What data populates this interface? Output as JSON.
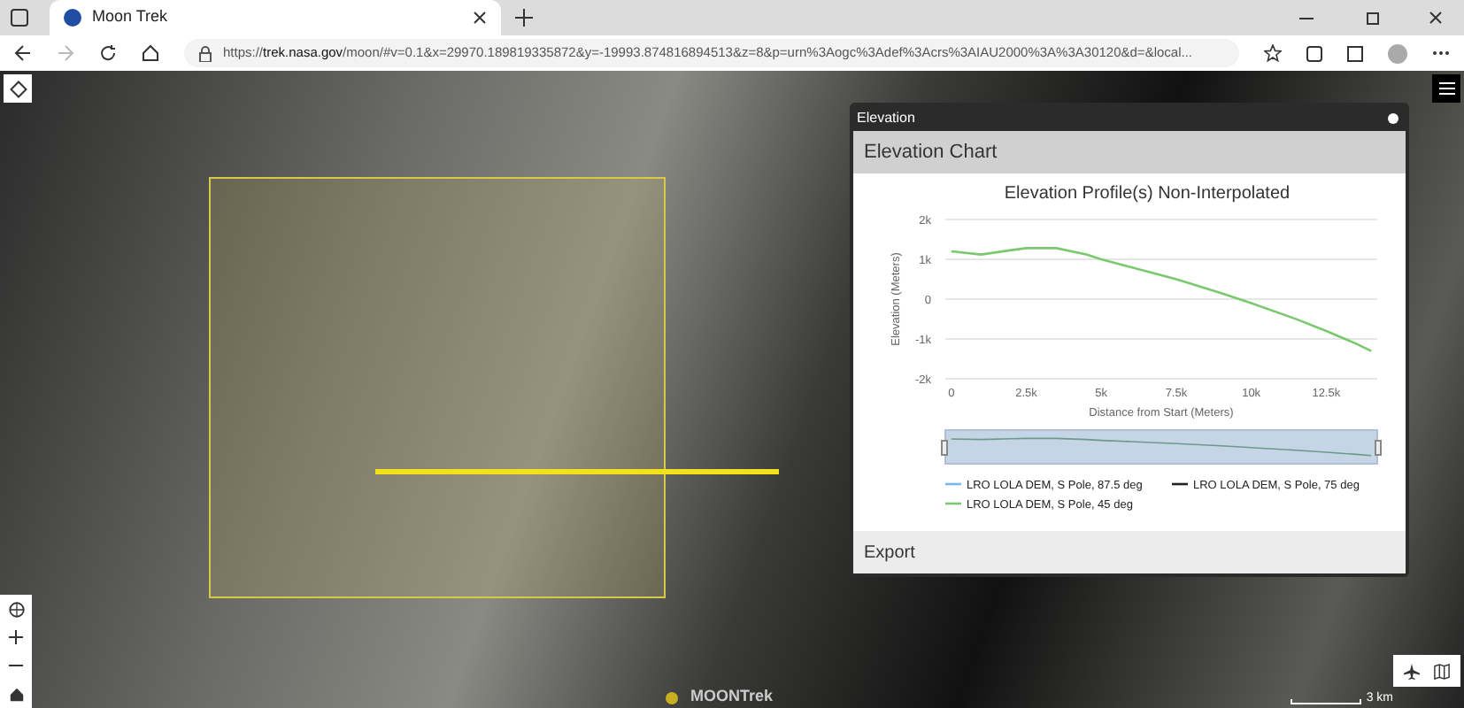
{
  "browser": {
    "tab_title": "Moon Trek",
    "url_prefix": "https://",
    "url_host": "trek.nasa.gov",
    "url_rest": "/moon/#v=0.1&x=29970.189819335872&y=-19993.874816894513&z=8&p=urn%3Aogc%3Adef%3Acrs%3AIAU2000%3A%3A30120&d=&local..."
  },
  "panel": {
    "title": "Elevation",
    "section": "Elevation Chart",
    "footer": "Export",
    "chart_data": {
      "type": "line",
      "grid": true,
      "title": "Elevation Profile(s) Non-Interpolated",
      "xlabel": "Distance from Start (Meters)",
      "ylabel": "Elevation (Meters)",
      "x": [
        0,
        1000,
        2000,
        2500,
        3500,
        4500,
        5000,
        6000,
        7500,
        9000,
        10000,
        11500,
        12500,
        13500,
        14000
      ],
      "xlim": [
        -200,
        14200
      ],
      "ylim": [
        -2000,
        2000
      ],
      "xticks": [
        {
          "value": 0,
          "label": "0"
        },
        {
          "value": 2500,
          "label": "2.5k"
        },
        {
          "value": 5000,
          "label": "5k"
        },
        {
          "value": 7500,
          "label": "7.5k"
        },
        {
          "value": 10000,
          "label": "10k"
        },
        {
          "value": 12500,
          "label": "12.5k"
        }
      ],
      "yticks": [
        {
          "value": 2000,
          "label": "2k"
        },
        {
          "value": 1000,
          "label": "1k"
        },
        {
          "value": 0,
          "label": "0"
        },
        {
          "value": -1000,
          "label": "-1k"
        },
        {
          "value": -2000,
          "label": "-2k"
        }
      ],
      "series": [
        {
          "name": "LRO LOLA DEM, S Pole, 87.5 deg",
          "color": "#7cb5ec",
          "values": [
            null,
            null,
            null,
            null,
            null,
            null,
            null,
            null,
            null,
            null,
            null,
            null,
            null,
            null,
            null
          ]
        },
        {
          "name": "LRO LOLA DEM, S Pole, 75 deg",
          "color": "#222222",
          "values": [
            null,
            null,
            null,
            null,
            null,
            null,
            null,
            null,
            null,
            null,
            null,
            null,
            null,
            null,
            null
          ]
        },
        {
          "name": "LRO LOLA DEM, S Pole, 45 deg",
          "color": "#7bc96f",
          "values": [
            1200,
            1120,
            1230,
            1280,
            1280,
            1120,
            1000,
            800,
            500,
            150,
            -100,
            -500,
            -800,
            -1120,
            -1300
          ]
        }
      ]
    }
  },
  "map": {
    "logo": "MOONTrek",
    "scale": "3 km"
  }
}
